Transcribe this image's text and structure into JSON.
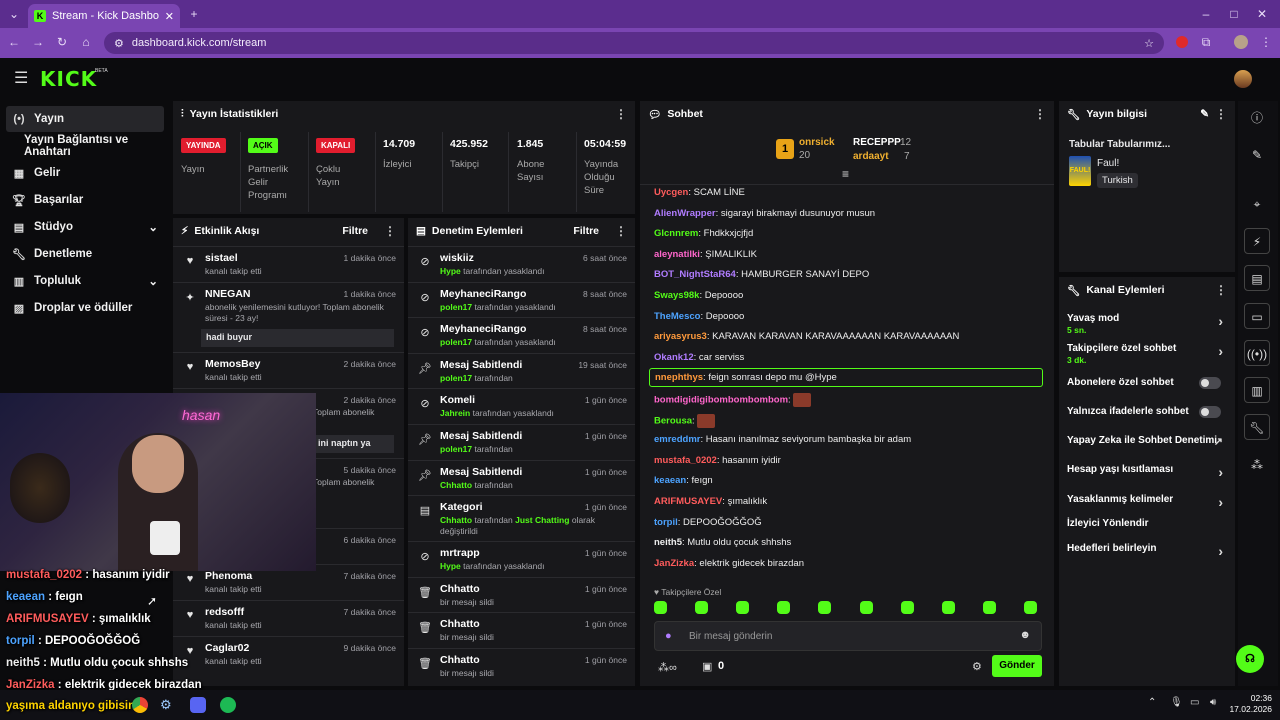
{
  "browser": {
    "tab_title": "Stream - Kick Dashboard",
    "url": "dashboard.kick.com/stream"
  },
  "brand": {
    "logo": "KICK",
    "beta": "BETA",
    "accent": "#53fc18"
  },
  "sidebar": {
    "items": [
      {
        "label": "Yayın",
        "icon": "broadcast-icon"
      },
      {
        "label": "Yayın Bağlantısı ve Anahtarı",
        "icon": ""
      },
      {
        "label": "Gelir",
        "icon": "dollar-icon"
      },
      {
        "label": "Başarılar",
        "icon": "trophy-icon"
      },
      {
        "label": "Stüdyo",
        "icon": "layout-icon"
      },
      {
        "label": "Denetleme",
        "icon": "wrench-icon"
      },
      {
        "label": "Topluluk",
        "icon": "people-icon"
      },
      {
        "label": "Droplar ve ödüller",
        "icon": "gift-icon"
      }
    ]
  },
  "stats": {
    "title": "Yayın İstatistikleri",
    "live_badge": "YAYINDA",
    "live_label": "Yayın",
    "partner_badge": "AÇIK",
    "partner_label": "Partnerlik Gelir Programı",
    "multi_badge": "KAPALI",
    "multi_label": "Çoklu Yayın",
    "viewers": "14.709",
    "viewers_label": "İzleyici",
    "followers": "425.952",
    "followers_label": "Takipçi",
    "subs": "1.845",
    "subs_label": "Abone Sayısı",
    "uptime": "05:04:59",
    "uptime_label": "Yayında Olduğu Süre"
  },
  "activity": {
    "title": "Etkinlik Akışı",
    "filter": "Filtre",
    "items": [
      {
        "name": "sistael",
        "sub": "kanalı takip etti",
        "time": "1 dakika önce"
      },
      {
        "name": "NNEGAN",
        "sub": "abonelik yenilemesini kutluyor! Toplam abonelik süresi - 23 ay!",
        "msg": "hadi buyur",
        "time": "1 dakika önce"
      },
      {
        "name": "MemosBey",
        "sub": "kanalı takip etti",
        "time": "2 dakika önce"
      },
      {
        "name": "",
        "sub": "Toplam abonelik",
        "msg": "ini naptın ya",
        "time": "2 dakika önce"
      },
      {
        "name": "",
        "sub": "Toplam abonelik",
        "time": "5 dakika önce"
      },
      {
        "name": "",
        "sub": "",
        "time": "6 dakika önce"
      },
      {
        "name": "Phenoma",
        "sub": "kanalı takip etti",
        "time": "7 dakika önce"
      },
      {
        "name": "redsofff",
        "sub": "kanalı takip etti",
        "time": "7 dakika önce"
      },
      {
        "name": "Caglar02",
        "sub": "kanalı takip etti",
        "time": "9 dakika önce"
      }
    ]
  },
  "moderation": {
    "title": "Denetim Eylemleri",
    "filter": "Filtre",
    "items": [
      {
        "name": "wiskiiz",
        "by": "Hype",
        "sub": "tarafından yasaklandı",
        "time": "6 saat önce",
        "icon": "ban-icon"
      },
      {
        "name": "MeyhaneciRango",
        "by": "polen17",
        "sub": "tarafından yasaklandı",
        "time": "8 saat önce",
        "icon": "ban-icon"
      },
      {
        "name": "MeyhaneciRango",
        "by": "polen17",
        "sub": "tarafından yasaklandı",
        "time": "8 saat önce",
        "icon": "ban-icon"
      },
      {
        "name": "Mesaj Sabitlendi",
        "by": "polen17",
        "sub": "tarafından",
        "time": "19 saat önce",
        "icon": "pin-icon"
      },
      {
        "name": "Komeli",
        "by": "Jahrein",
        "sub": "tarafından yasaklandı",
        "time": "1 gün önce",
        "icon": "ban-icon"
      },
      {
        "name": "Mesaj Sabitlendi",
        "by": "polen17",
        "sub": "tarafından",
        "time": "1 gün önce",
        "icon": "pin-icon"
      },
      {
        "name": "Mesaj Sabitlendi",
        "by": "Chhatto",
        "sub": "tarafından",
        "time": "1 gün önce",
        "icon": "pin-icon"
      },
      {
        "name": "Kategori",
        "by": "Chhatto",
        "sub": "tarafından",
        "cat": "Just Chatting",
        "sub2": "olarak değiştirildi",
        "time": "1 gün önce",
        "icon": "category-icon"
      },
      {
        "name": "mrtrapp",
        "by": "Hype",
        "sub": "tarafından yasaklandı",
        "time": "1 gün önce",
        "icon": "ban-icon"
      },
      {
        "name": "Chhatto",
        "by": "",
        "sub": "bir mesajı sildi",
        "time": "1 gün önce",
        "icon": "trash-icon"
      },
      {
        "name": "Chhatto",
        "by": "",
        "sub": "bir mesajı sildi",
        "time": "1 gün önce",
        "icon": "trash-icon"
      },
      {
        "name": "Chhatto",
        "by": "",
        "sub": "bir mesajı sildi",
        "time": "1 gün önce",
        "icon": "trash-icon"
      }
    ]
  },
  "chat": {
    "title": "Sohbet",
    "leader1": {
      "rank": "1",
      "name": "onrsick",
      "count": "20"
    },
    "leader2": {
      "name": "RECEPPP",
      "count": "12"
    },
    "leader3": {
      "name": "ardaayt",
      "count": "7"
    },
    "messages": [
      {
        "user": "Uycgen",
        "color": "#ff5c5c",
        "text": "SCAM LİNE"
      },
      {
        "user": "AlienWrapper",
        "color": "#b07cff",
        "text": "sigarayi birakmayi dusunuyor musun"
      },
      {
        "user": "Glcnnrem",
        "color": "#53fc18",
        "text": "Fhdkkxjcjfjd"
      },
      {
        "user": "aleynatilki",
        "color": "#ff66cc",
        "text": "ŞIMALIKLIK"
      },
      {
        "user": "BOT_NightStaR64",
        "color": "#b07cff",
        "text": "HAMBURGER SANAYİ DEPO"
      },
      {
        "user": "Sways98k",
        "color": "#53fc18",
        "text": "Depoooo"
      },
      {
        "user": "TheMesco",
        "color": "#4da3ff",
        "text": "Depoooo"
      },
      {
        "user": "ariyasyrus3",
        "color": "#ff9a3c",
        "text": "KARAVAN KARAVAN KARAVAAAAAAN KARAVAAAAAAN"
      },
      {
        "user": "Okank12",
        "color": "#b07cff",
        "text": "car serviss"
      },
      {
        "user": "nnephthys",
        "color": "#ff9a3c",
        "text": "feign sonrası depo mu @Hype"
      },
      {
        "user": "bomdigidigibombombombom",
        "color": "#ff66cc",
        "text": ""
      },
      {
        "user": "Berousa",
        "color": "#53fc18",
        "text": ""
      },
      {
        "user": "emreddmr",
        "color": "#4da3ff",
        "text": "Hasanı inanılmaz seviyorum bambaşka bir adam"
      },
      {
        "user": "mustafa_0202",
        "color": "#ff5c5c",
        "text": "hasanım iyidir"
      },
      {
        "user": "keaean",
        "color": "#4da3ff",
        "text": "feıgn"
      },
      {
        "user": "ARIFMUSAYEV",
        "color": "#ff5c5c",
        "text": "şımalıklık"
      },
      {
        "user": "torpil",
        "color": "#4da3ff",
        "text": "DEPOOĞOĞĞOĞ"
      },
      {
        "user": "neith5",
        "color": "#eeeeee",
        "text": "Mutlu oldu çocuk shhshs"
      },
      {
        "user": "JanZizka",
        "color": "#ff5c5c",
        "text": "elektrik gidecek birazdan"
      }
    ],
    "followers_only": "Takipçilere Özel",
    "input_placeholder": "Bir mesaj gönderin",
    "points": "0",
    "send_label": "Gönder"
  },
  "stream_info": {
    "title": "Yayın bilgisi",
    "stream_title": "Tabular Tabularımız...",
    "category": "Faul!",
    "language": "Turkish"
  },
  "channel_actions": {
    "title": "Kanal Eylemleri",
    "items": [
      {
        "label": "Yavaş mod",
        "sub": "5 sn.",
        "ctrl": "chevron"
      },
      {
        "label": "Takipçilere özel sohbet",
        "sub": "3 dk.",
        "ctrl": "chevron"
      },
      {
        "label": "Abonelere özel sohbet",
        "sub": "",
        "ctrl": "toggle"
      },
      {
        "label": "Yalnızca ifadelerle sohbet",
        "sub": "",
        "ctrl": "toggle"
      },
      {
        "label": "Yapay Zeka ile Sohbet Denetimi",
        "sub": "",
        "ctrl": "external"
      },
      {
        "label": "Hesap yaşı kısıtlaması",
        "sub": "",
        "ctrl": "chevron"
      },
      {
        "label": "Yasaklanmış kelimeler",
        "sub": "",
        "ctrl": "chevron"
      },
      {
        "label": "İzleyici Yönlendir",
        "sub": "",
        "ctrl": "none"
      },
      {
        "label": "Hedefleri belirleyin",
        "sub": "",
        "ctrl": "chevron"
      }
    ]
  },
  "overlay_chat": [
    {
      "user": "mustafa_0202",
      "color": "#ff5c5c",
      "text": "hasanım iyidir"
    },
    {
      "user": "keaean",
      "color": "#4da3ff",
      "text": "feıgn"
    },
    {
      "user": "ARIFMUSAYEV",
      "color": "#ff5c5c",
      "text": "şımalıklık"
    },
    {
      "user": "torpil",
      "color": "#4da3ff",
      "text": "DEPOOĞOĞĞOĞ"
    },
    {
      "user": "neith5",
      "color": "#eeeeee",
      "text": "Mutlu oldu çocuk shhshs"
    },
    {
      "user": "JanZizka",
      "color": "#ff5c5c",
      "text": "elektrik gidecek birazdan"
    }
  ],
  "overlay_bottom": "yaşıma aldanıyo gibisin",
  "taskbar": {
    "time": "02:36",
    "date": "17.02.2026"
  }
}
